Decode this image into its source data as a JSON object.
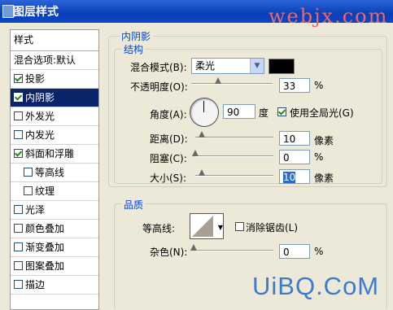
{
  "window": {
    "title": "图层样式"
  },
  "watermark_top": "webjx.com",
  "watermark_bottom": "UiBQ.CoM",
  "left_panel": {
    "header": "样式",
    "items": [
      {
        "label": "混合选项:默认",
        "checkbox": false,
        "checked": false,
        "selected": false,
        "indent": false
      },
      {
        "label": "投影",
        "checkbox": true,
        "checked": true,
        "selected": false,
        "indent": false
      },
      {
        "label": "内阴影",
        "checkbox": true,
        "checked": true,
        "selected": true,
        "indent": false
      },
      {
        "label": "外发光",
        "checkbox": true,
        "checked": false,
        "selected": false,
        "indent": false
      },
      {
        "label": "内发光",
        "checkbox": true,
        "checked": false,
        "selected": false,
        "indent": false
      },
      {
        "label": "斜面和浮雕",
        "checkbox": true,
        "checked": true,
        "selected": false,
        "indent": false
      },
      {
        "label": "等高线",
        "checkbox": true,
        "checked": false,
        "selected": false,
        "indent": true
      },
      {
        "label": "纹理",
        "checkbox": true,
        "checked": false,
        "selected": false,
        "indent": true
      },
      {
        "label": "光泽",
        "checkbox": true,
        "checked": false,
        "selected": false,
        "indent": false
      },
      {
        "label": "颜色叠加",
        "checkbox": true,
        "checked": false,
        "selected": false,
        "indent": false
      },
      {
        "label": "渐变叠加",
        "checkbox": true,
        "checked": false,
        "selected": false,
        "indent": false
      },
      {
        "label": "图案叠加",
        "checkbox": true,
        "checked": false,
        "selected": false,
        "indent": false
      },
      {
        "label": "描边",
        "checkbox": true,
        "checked": false,
        "selected": false,
        "indent": false
      }
    ]
  },
  "inner_shadow": {
    "section_title": "内阴影",
    "structure_title": "结构",
    "blend_mode_label": "混合模式(B):",
    "blend_mode_value": "柔光",
    "shadow_color": "#000000",
    "opacity_label": "不透明度(O):",
    "opacity_value": "33",
    "opacity_unit": "%",
    "angle_label": "角度(A):",
    "angle_value": "90",
    "angle_unit": "度",
    "global_light_label": "使用全局光(G)",
    "global_light_checked": true,
    "distance_label": "距离(D):",
    "distance_value": "10",
    "distance_unit": "像素",
    "choke_label": "阻塞(C):",
    "choke_value": "0",
    "choke_unit": "%",
    "size_label": "大小(S):",
    "size_value": "10",
    "size_unit": "像素"
  },
  "quality": {
    "title": "品质",
    "contour_label": "等高线:",
    "antialias_label": "消除锯齿(L)",
    "antialias_checked": false,
    "noise_label": "杂色(N):",
    "noise_value": "0",
    "noise_unit": "%"
  }
}
